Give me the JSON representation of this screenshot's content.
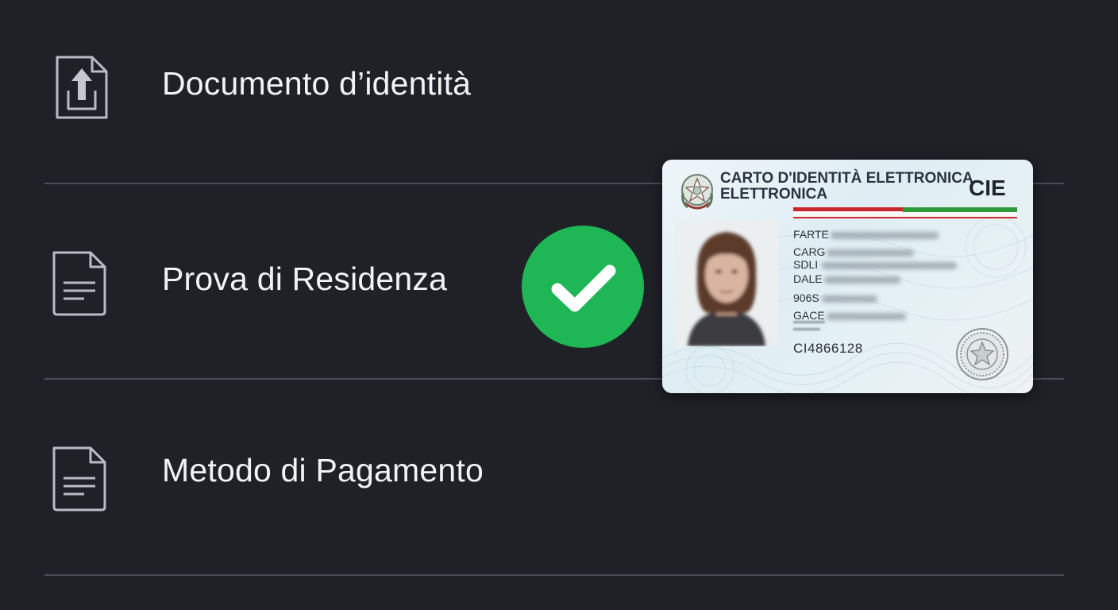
{
  "items": [
    {
      "label": "Documento d’identità",
      "icon": "file-upload-icon"
    },
    {
      "label": "Prova di Residenza",
      "icon": "document-icon"
    },
    {
      "label": "Metodo di Pagamento",
      "icon": "document-icon"
    }
  ],
  "status": {
    "icon": "checkmark-icon",
    "color": "#1fb655"
  },
  "card": {
    "title_line1": "CARTO D'IDENTITÀ ELETTRONICA",
    "title_line2": "ELETTRONICA",
    "code": "CIE",
    "fields": [
      "FARTE",
      "CARG",
      "SDLI",
      "DALE",
      "906S",
      "GACE"
    ],
    "number": "CI4866128"
  },
  "colors": {
    "background": "#1f2127",
    "text": "#f2f3f5",
    "divider": "#4a4d55",
    "success": "#1fb655"
  }
}
